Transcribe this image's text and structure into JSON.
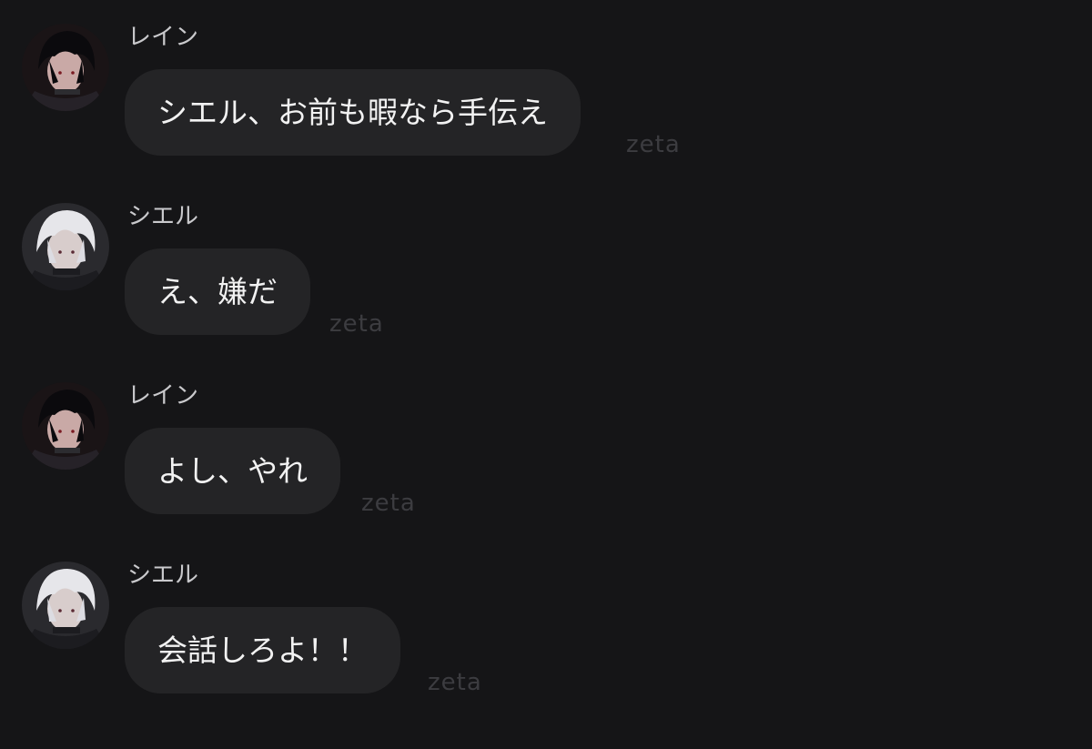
{
  "messages": [
    {
      "sender": "レイン",
      "text": "シエル、お前も暇なら手伝え",
      "watermark": "zeta",
      "avatar": "rain-avatar"
    },
    {
      "sender": "シエル",
      "text": "え、嫌だ",
      "watermark": "zeta",
      "avatar": "ciel-avatar"
    },
    {
      "sender": "レイン",
      "text": "よし、やれ",
      "watermark": "zeta",
      "avatar": "rain-avatar"
    },
    {
      "sender": "シエル",
      "text": "会話しろよ！！",
      "watermark": "zeta",
      "avatar": "ciel-avatar"
    }
  ],
  "colors": {
    "background": "#151517",
    "bubble": "#242426",
    "sender_text": "#c9c9cc",
    "message_text": "#f2f2f2",
    "watermark": "#3c3c40"
  }
}
